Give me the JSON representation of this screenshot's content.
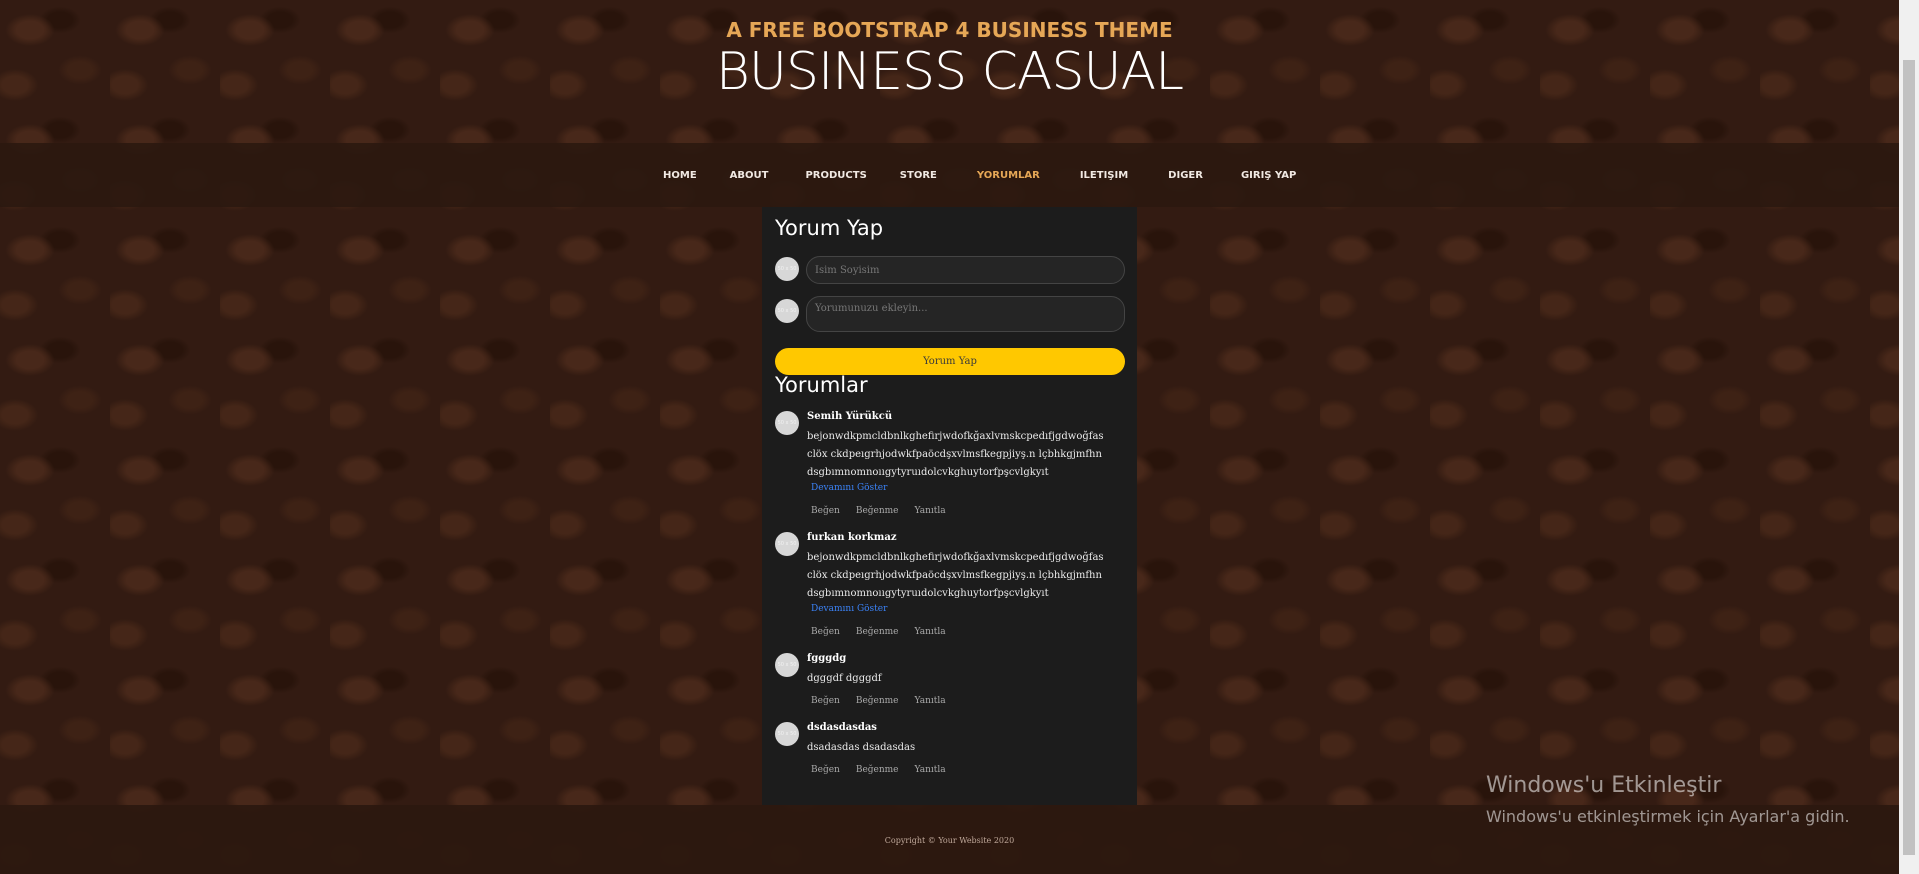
{
  "header": {
    "subtitle": "A FREE BOOTSTRAP 4 BUSINESS THEME",
    "title": "BUSINESS CASUAL"
  },
  "nav": {
    "items": [
      "HOME",
      "ABOUT",
      "PRODUCTS",
      "STORE",
      "YORUMLAR",
      "ILETIŞIM",
      "DIGER",
      "GIRIŞ YAP"
    ],
    "active": "YORUMLAR"
  },
  "form": {
    "heading": "Yorum Yap",
    "avatar_label": "50 x 50",
    "name_placeholder": "İsim Soyisim",
    "comment_placeholder": "Yorumunuzu ekleyin...",
    "submit_label": "Yorum Yap"
  },
  "comments_section": {
    "heading": "Yorumlar",
    "more_label": "Devamını Göster",
    "actions": [
      "Beğen",
      "Beğenme",
      "Yanıtla"
    ],
    "comments": [
      {
        "author": "Semih Yürükcü",
        "text": "bejonwdkpmcldbnlkghefirjwdofkğaxlvmskcpedıfjgdwoğfasclöx ckdpeıgrhjodwkfpaöcdşxvlmsfkegpjiyş.n lçbhkgjmfhndsgbımnomnoııgytyruıdolcvkghuytorfpşcvlgkyıt",
        "truncated": true
      },
      {
        "author": "furkan korkmaz",
        "text": "bejonwdkpmcldbnlkghefirjwdofkğaxlvmskcpedıfjgdwoğfasclöx ckdpeıgrhjodwkfpaöcdşxvlmsfkegpjiyş.n lçbhkgjmfhndsgbımnomnoııgytyruıdolcvkghuytorfpşcvlgkyıt",
        "truncated": true
      },
      {
        "author": "fgggdg",
        "text": "dgggdf dgggdf",
        "truncated": false
      },
      {
        "author": "dsdasdasdas",
        "text": "dsadasdas dsadasdas",
        "truncated": false
      }
    ]
  },
  "footer": {
    "copyright": "Copyright © Your Website 2020"
  },
  "watermark": {
    "title": "Windows'u Etkinleştir",
    "subtitle": "Windows'u etkinleştirmek için Ayarlar'a gidin."
  },
  "colors": {
    "accent": "#e6a756",
    "button": "#ffc800",
    "link": "#3b82f6"
  }
}
